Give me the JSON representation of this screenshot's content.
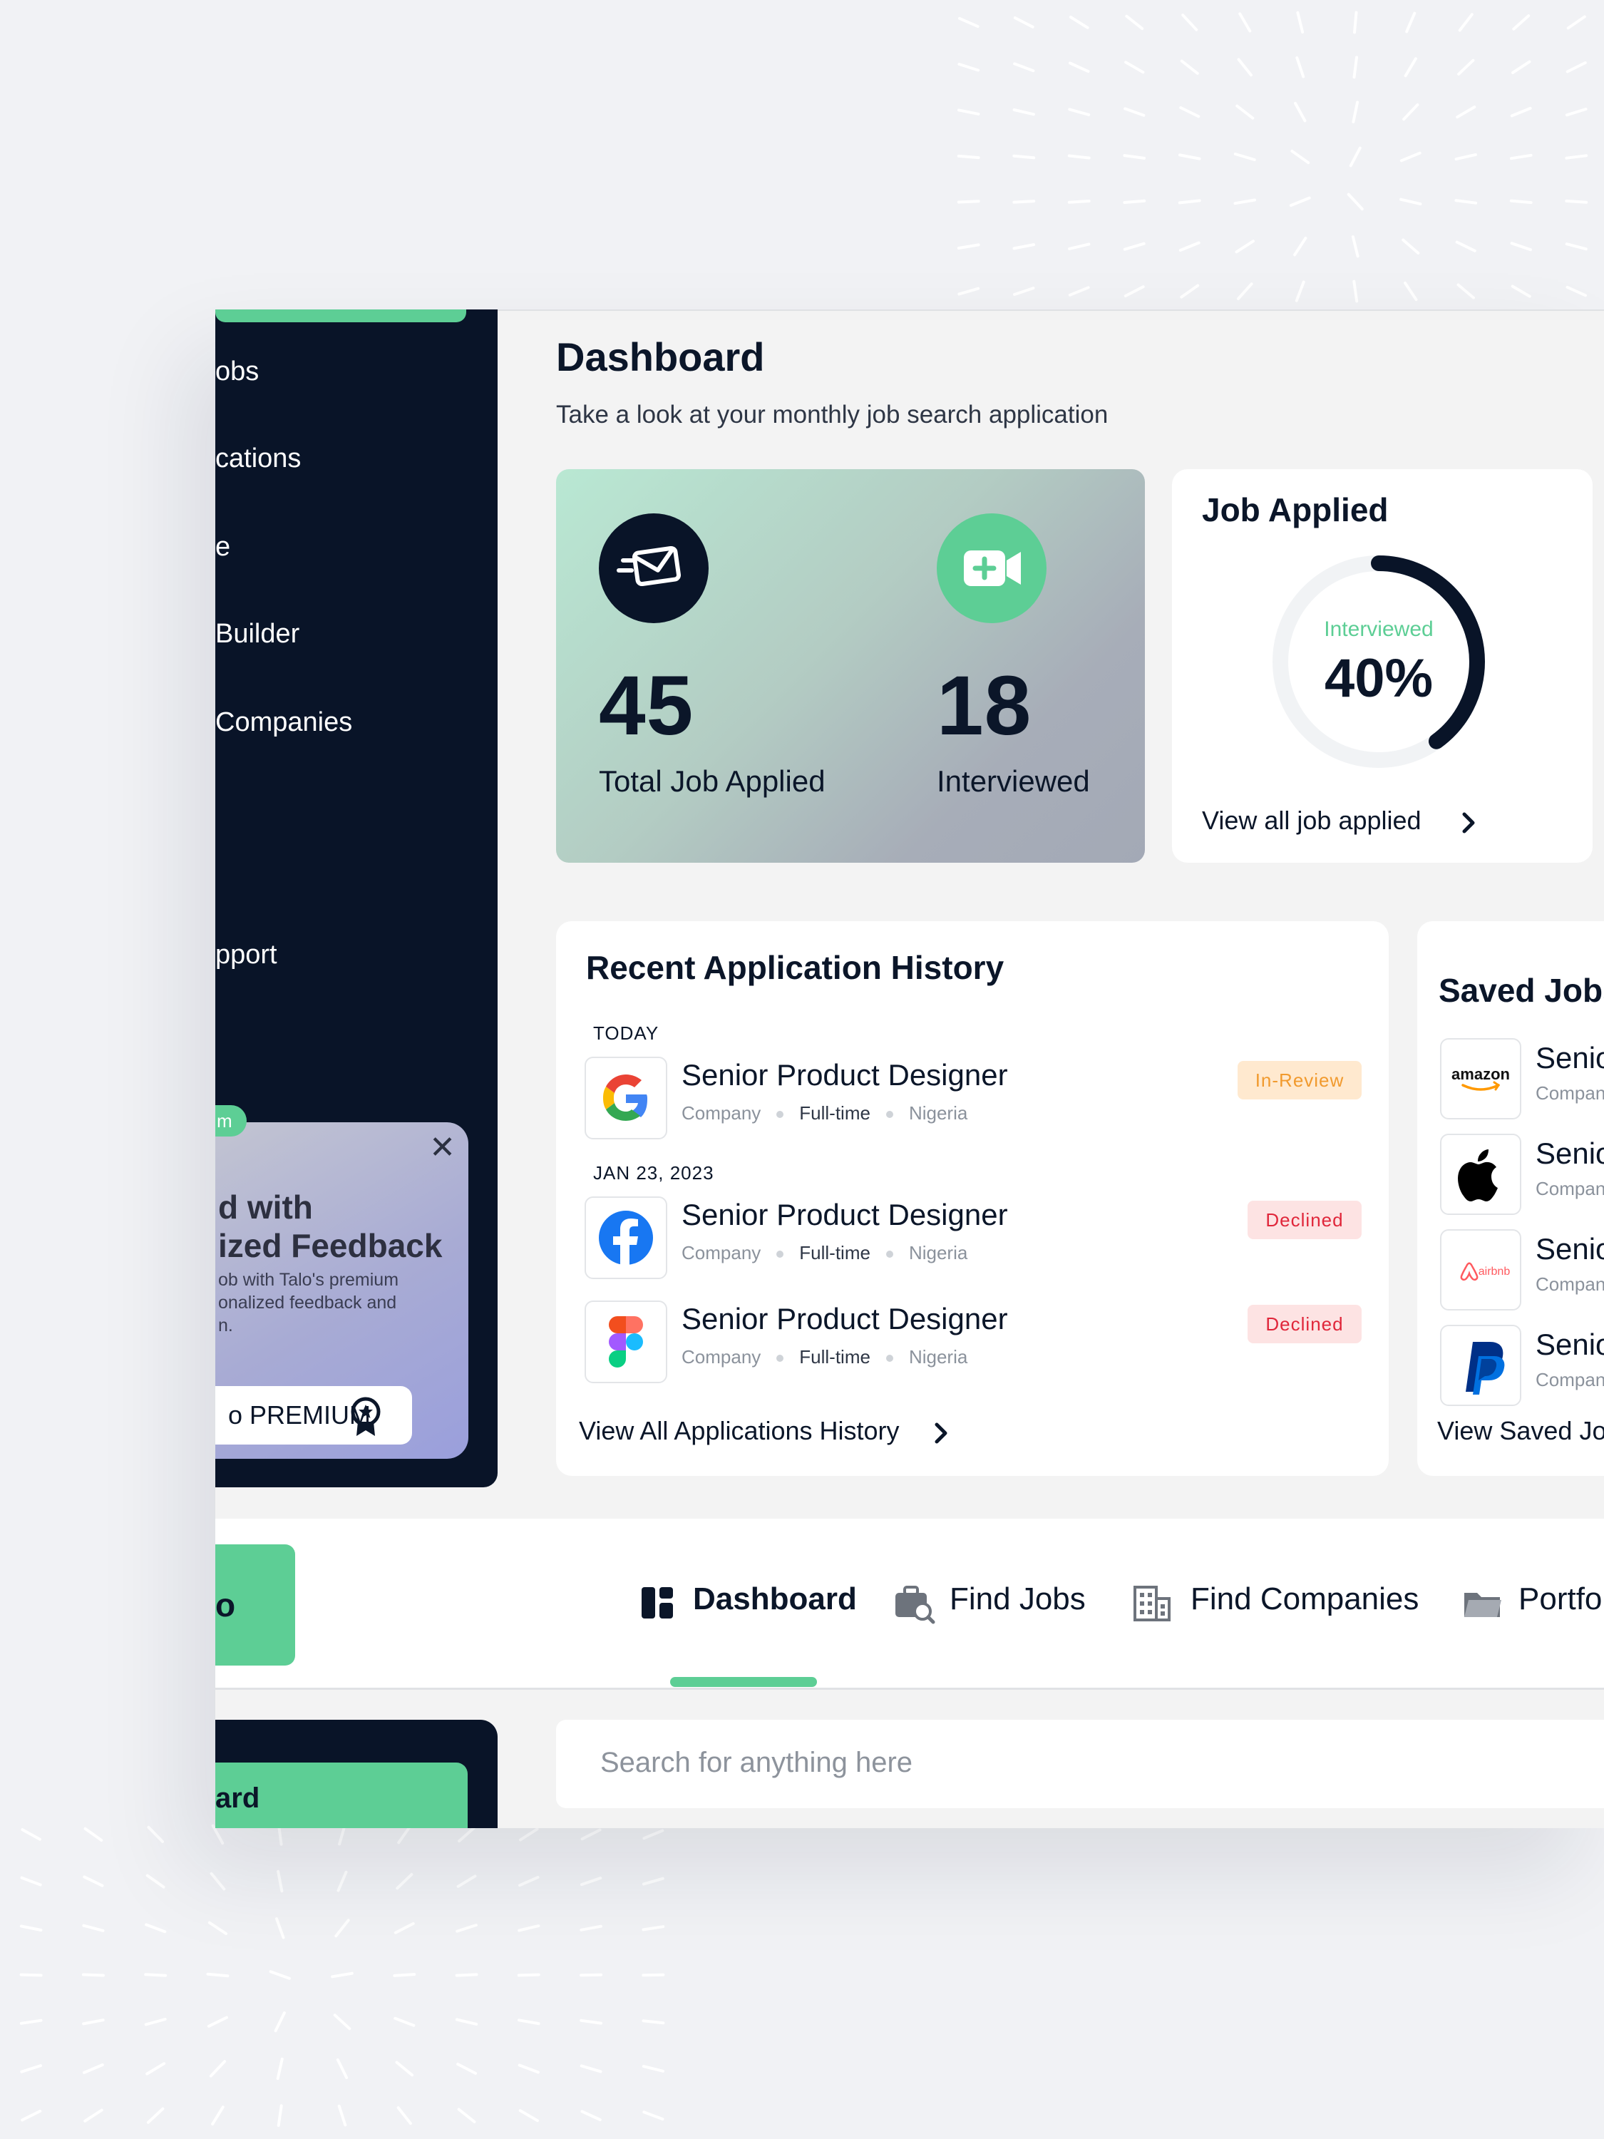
{
  "sidebar": {
    "items": [
      {
        "label": "obs"
      },
      {
        "label": "cations"
      },
      {
        "label": "e"
      },
      {
        "label": " Builder"
      },
      {
        "label": "Companies"
      },
      {
        "label": "pport"
      }
    ],
    "premium_badge": "m",
    "promo": {
      "title": "d with\nized Feedback",
      "description": "ob with Talo's premium\nonalized feedback and\nn.",
      "button_label": "o PREMIUM",
      "close_icon": "close-icon",
      "badge_icon": "award-icon"
    }
  },
  "header": {
    "title": "Dashboard",
    "subtitle": "Take a look at your monthly job search application"
  },
  "stats": {
    "total": {
      "value": "45",
      "label": "Total Job Applied",
      "icon": "mail-send-icon"
    },
    "interviewed": {
      "value": "18",
      "label": "Interviewed",
      "icon": "video-add-icon"
    }
  },
  "job_applied": {
    "title": "Job Applied",
    "donut_label": "Interviewed",
    "donut_value": "40%",
    "donut_fraction": 0.4,
    "link": "View all job applied"
  },
  "history": {
    "title": "Recent Application History",
    "groups": [
      {
        "day": "TODAY"
      },
      {
        "day": "JAN  23, 2023"
      }
    ],
    "rows": [
      {
        "title": "Senior Product Designer",
        "company": "Company",
        "type": "Full-time",
        "location": "Nigeria",
        "status": "In-Review",
        "logo": "google-logo"
      },
      {
        "title": "Senior Product Designer",
        "company": "Company",
        "type": "Full-time",
        "location": "Nigeria",
        "status": "Declined",
        "logo": "facebook-logo"
      },
      {
        "title": "Senior Product Designer",
        "company": "Company",
        "type": "Full-time",
        "location": "Nigeria",
        "status": "Declined",
        "logo": "figma-logo"
      }
    ],
    "link": "View All Applications History"
  },
  "saved": {
    "title": "Saved Jobs",
    "rows": [
      {
        "title": "Senio",
        "sub": "Compan",
        "logo": "amazon-logo",
        "logo_text": "amazon"
      },
      {
        "title": "Senio",
        "sub": "Compan",
        "logo": "apple-logo"
      },
      {
        "title": "Senio",
        "sub": "Compan",
        "logo": "airbnb-logo",
        "logo_text": "airbnb"
      },
      {
        "title": "Senio",
        "sub": "Compan",
        "logo": "paypal-logo"
      }
    ],
    "link": "View Saved Jo"
  },
  "topnav": {
    "logo_text": "o",
    "tabs": [
      {
        "label": "Dashboard",
        "icon": "dashboard-icon",
        "active": true
      },
      {
        "label": "Find Jobs",
        "icon": "briefcase-search-icon"
      },
      {
        "label": "Find Companies",
        "icon": "building-icon"
      },
      {
        "label": "Portfo",
        "icon": "folder-icon"
      }
    ]
  },
  "mini_sidebar": {
    "active_label": "ard"
  },
  "search": {
    "placeholder": "Search for anything here"
  },
  "colors": {
    "accent": "#5dce95",
    "navy": "#091428",
    "review": "#f19a2e",
    "declined": "#e0263a"
  }
}
